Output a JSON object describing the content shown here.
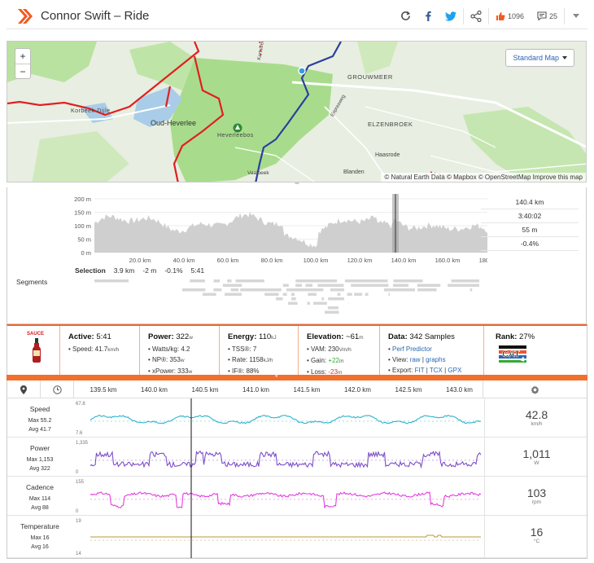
{
  "header": {
    "title": "Connor Swift – Ride",
    "kudos_count": "1096",
    "comments_count": "25"
  },
  "colors": {
    "accent": "#f26f2d",
    "route_red": "#e02020",
    "route_blue": "#2b3f9e",
    "brand_orange": "#f15a22"
  },
  "map": {
    "zoom_in": "+",
    "zoom_out": "−",
    "map_type": "Standard Map",
    "attribution": "© Natural Earth Data © Mapbox © OpenStreetMap Improve this map",
    "labels": [
      "Oud-Heverlee",
      "Korbeek-Dijle",
      "Heverleebos",
      "GROUWMEER",
      "ELZENBROEK",
      "Haasrode",
      "Blanden",
      "Vaalbeek",
      "Expresweg",
      "Kartuizer"
    ]
  },
  "elevation": {
    "y_ticks": [
      "200 m",
      "150 m",
      "100 m",
      "50 m",
      "0 m"
    ],
    "x_ticks": [
      "20.0 km",
      "40.0 km",
      "60.0 km",
      "80.0 km",
      "100.0 km",
      "120.0 km",
      "140.0 km",
      "160.0 km",
      "180.0 km"
    ],
    "stats": [
      "140.4 km",
      "3:40:02",
      "55 m",
      "-0.4%"
    ],
    "selection_label": "Selection",
    "selection_values": [
      "3.9 km",
      "-2 m",
      "-0.1%",
      "5:41"
    ],
    "segments_label": "Segments"
  },
  "summary": {
    "sauce_label": "SAUCE",
    "active": {
      "title": "Active:",
      "value": "5:41",
      "rows": [
        {
          "label": "Speed:",
          "value": "41.7",
          "unit": "km/h"
        }
      ]
    },
    "power": {
      "title": "Power:",
      "value": "322",
      "unit": "w",
      "rows": [
        {
          "label": "Watts/kg:",
          "value": "4.2",
          "unit": ""
        },
        {
          "label": "NP®:",
          "value": "353",
          "unit": "w"
        },
        {
          "label": "xPower:",
          "value": "333",
          "unit": "w"
        }
      ]
    },
    "energy": {
      "title": "Energy:",
      "value": "110",
      "unit": "kJ",
      "rows": [
        {
          "label": "TSS®:",
          "value": "7",
          "unit": ""
        },
        {
          "label": "Rate:",
          "value": "1158",
          "unit": "kJ/h"
        },
        {
          "label": "IF®:",
          "value": "88%",
          "unit": ""
        }
      ]
    },
    "elevation": {
      "title": "Elevation:",
      "value": "~61",
      "unit": "m",
      "rows": [
        {
          "label": "VAM:",
          "value": "230",
          "unit": "Vm/h"
        },
        {
          "label": "Gain:",
          "value": "+22",
          "unit": "m"
        },
        {
          "label": "Loss:",
          "value": "-23",
          "unit": "m"
        }
      ]
    },
    "data": {
      "title": "Data:",
      "value": "342 Samples",
      "perf_predictor": "Perf Predictor",
      "view_label": "View:",
      "view_raw": "raw",
      "view_sep": "|",
      "view_graphs": "graphs",
      "export_label": "Export:",
      "export_fit": "FIT",
      "export_tcx": "TCX",
      "export_gpx": "GPX"
    },
    "rank": {
      "title": "Rank:",
      "value": "27%",
      "cat": "CAT",
      "cat_num": "4"
    }
  },
  "orange_bar_marker": "*",
  "time_axis": {
    "ticks": [
      "139.5 km",
      "140.0 km",
      "140.5 km",
      "141.0 km",
      "141.5 km",
      "142.0 km",
      "142.5 km",
      "143.0 km"
    ]
  },
  "streams": [
    {
      "name": "Speed",
      "max": "Max 55.2",
      "avg": "Avg 41.7",
      "ytop": "67.8",
      "ybot": "7.6",
      "value": "42.8",
      "unit": "km/h",
      "color": "#2fb3cf"
    },
    {
      "name": "Power",
      "max": "Max 1,153",
      "avg": "Avg 322",
      "ytop": "1,335",
      "ybot": "0",
      "value": "1,011",
      "unit": "W",
      "color": "#7d4fc9"
    },
    {
      "name": "Cadence",
      "max": "Max 114",
      "avg": "Avg 88",
      "ytop": "155",
      "ybot": "0",
      "value": "103",
      "unit": "rpm",
      "color": "#e23fe0"
    },
    {
      "name": "Temperature",
      "max": "Max 16",
      "avg": "Avg 16",
      "ytop": "19",
      "ybot": "14",
      "value": "16",
      "unit": "°C",
      "color": "#b59a3a"
    }
  ]
}
